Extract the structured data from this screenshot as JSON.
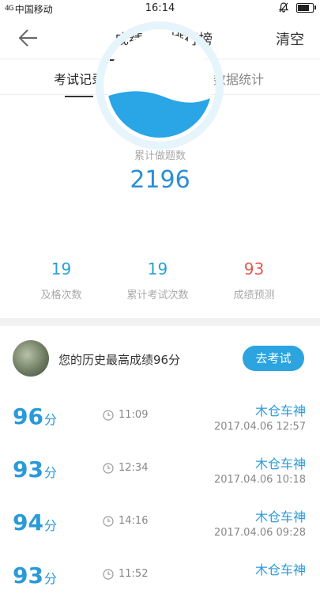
{
  "status": {
    "signal_text": "4G",
    "carrier": "中国移动",
    "time": "16:14"
  },
  "nav": {
    "tab_score": "成绩",
    "tab_rank": "排行榜",
    "clear": "清空"
  },
  "subtabs": {
    "records": "考试记录",
    "stats": "数据统计"
  },
  "gauge": {
    "label": "累计做题数",
    "value": "2196",
    "fill_fraction": 0.4
  },
  "stats": [
    {
      "value": "19",
      "label": "及格次数"
    },
    {
      "value": "19",
      "label": "累计考试次数"
    },
    {
      "value": "93",
      "label": "成绩预测"
    }
  ],
  "best": {
    "text": "您的历史最高成绩96分",
    "button": "去考试"
  },
  "records": [
    {
      "score": "96",
      "unit": "分",
      "duration": "11:09",
      "name": "木仓车神",
      "date": "2017.04.06  12:57"
    },
    {
      "score": "93",
      "unit": "分",
      "duration": "12:34",
      "name": "木仓车神",
      "date": "2017.04.06  10:18"
    },
    {
      "score": "94",
      "unit": "分",
      "duration": "14:16",
      "name": "木仓车神",
      "date": "2017.04.06  09:28"
    },
    {
      "score": "93",
      "unit": "分",
      "duration": "11:52",
      "name": "木仓车神",
      "date": ""
    }
  ],
  "colors": {
    "accent": "#2ba4df",
    "prediction": "#e05a4e"
  }
}
